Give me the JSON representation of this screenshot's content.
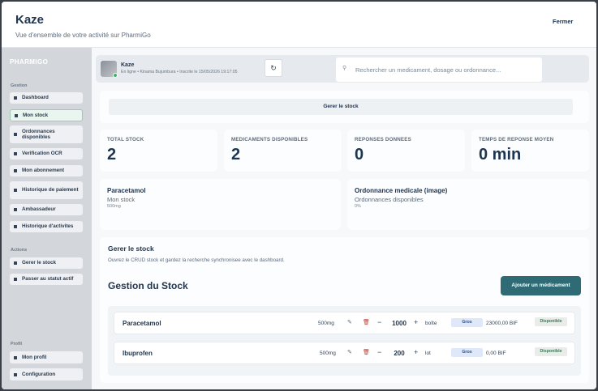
{
  "header": {
    "title": "Kaze",
    "subtitle": "Vue d'ensemble de votre activité sur PharmiGo",
    "close_label": "Fermer"
  },
  "sidebar": {
    "brand": "PHARMIGO",
    "gestion_label": "Gestion",
    "gestion_items": [
      {
        "label": "Dashboard"
      },
      {
        "label": "Mon stock",
        "active": true
      },
      {
        "label": "Ordonnances disponibles"
      },
      {
        "label": "Verification OCR"
      },
      {
        "label": "Mon abonnement"
      },
      {
        "label": "Historique de paiement"
      },
      {
        "label": "Ambassadeur"
      },
      {
        "label": "Historique d'activites"
      }
    ],
    "actions_label": "Actions",
    "actions_items": [
      {
        "label": "Gerer le stock"
      },
      {
        "label": "Passer au statut actif"
      }
    ],
    "profil_label": "Profil",
    "profil_items": [
      {
        "label": "Mon profil"
      },
      {
        "label": "Configuration"
      }
    ]
  },
  "profile": {
    "name": "Kaze",
    "meta": "En ligne • Kinama Bujumbura • Inscrite le 15/05/2026 19:17:05",
    "refresh_icon": "refresh-icon"
  },
  "search": {
    "placeholder": "Rechercher un medicament, dosage ou ordonnance...",
    "value": ""
  },
  "manage_button": "Gerer le stock",
  "stats": [
    {
      "title": "TOTAL STOCK",
      "value": "2"
    },
    {
      "title": "MEDICAMENTS DISPONIBLES",
      "value": "2"
    },
    {
      "title": "REPONSES DONNEES",
      "value": "0"
    },
    {
      "title": "TEMPS DE REPONSE MOYEN",
      "value": "0 min"
    }
  ],
  "info_cards": [
    {
      "title": "Paracetamol",
      "subtitle": "Mon stock",
      "detail": "500mg"
    },
    {
      "title": "Ordonnance medicale (image)",
      "subtitle": "Ordonnances disponibles",
      "detail": "0%"
    }
  ],
  "stock_section": {
    "title": "Gerer le stock",
    "description": "Ouvrez le CRUD stock et gardez la recherche synchronisee avec le dashboard.",
    "heading": "Gestion du Stock",
    "add_button": "Ajouter un médicament",
    "items": [
      {
        "name": "Paracetamol",
        "dosage": "500mg",
        "quantity": "1000",
        "unit": "boîte",
        "type": "Gros",
        "price": "23000,00 BIF",
        "status": "Disponible"
      },
      {
        "name": "Ibuprofen",
        "dosage": "500mg",
        "quantity": "200",
        "unit": "lot",
        "type": "Gros",
        "price": "0,00 BIF",
        "status": "Disponible"
      }
    ]
  },
  "colors": {
    "accent": "#2e6b74",
    "sidebar_bg": "#d3d7dc",
    "title": "#22364f",
    "status_green": "#3a7a5a"
  }
}
